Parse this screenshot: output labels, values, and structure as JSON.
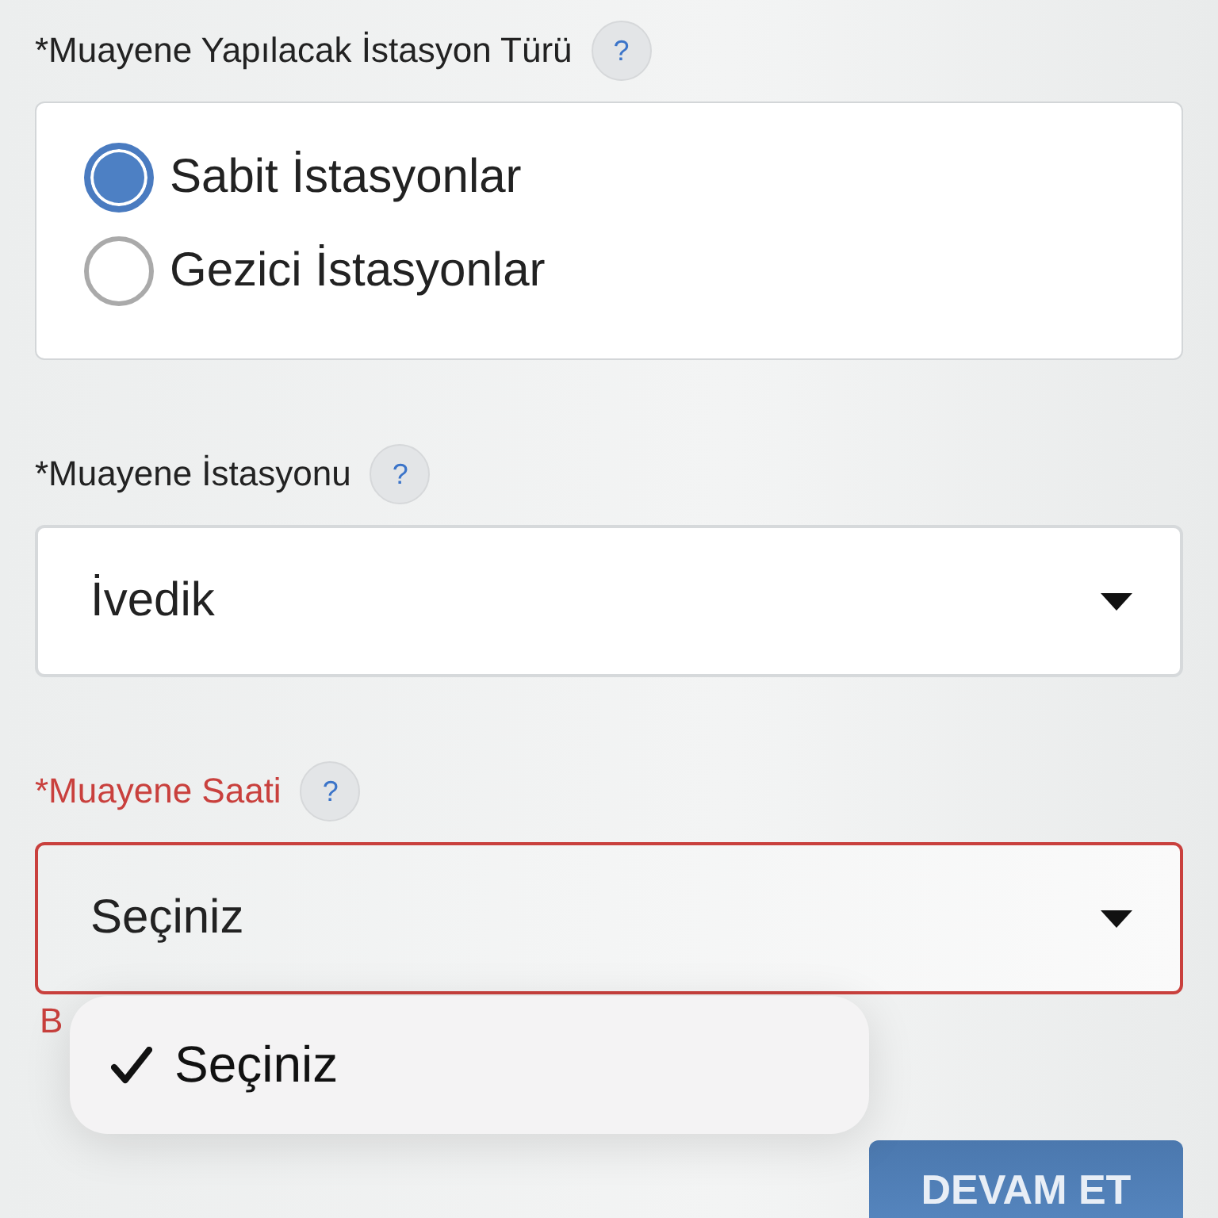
{
  "fields": [
    {
      "kind": "radio",
      "label": "*Muayene Yapılacak İstasyon Türü",
      "help": "?",
      "error": false,
      "options": [
        {
          "label": "Sabit İstasyonlar",
          "selected": true
        },
        {
          "label": "Gezici İstasyonlar",
          "selected": false
        }
      ]
    },
    {
      "kind": "select",
      "label": "*Muayene İstasyonu",
      "help": "?",
      "error": false,
      "value": "İvedik"
    },
    {
      "kind": "select",
      "label": "*Muayene Saati",
      "help": "?",
      "error": true,
      "value": "Seçiniz",
      "error_message": "B"
    }
  ],
  "dropdown_menu": {
    "items": [
      {
        "label": "Seçiniz",
        "selected": true
      }
    ]
  },
  "submit_button": "DEVAM ET"
}
